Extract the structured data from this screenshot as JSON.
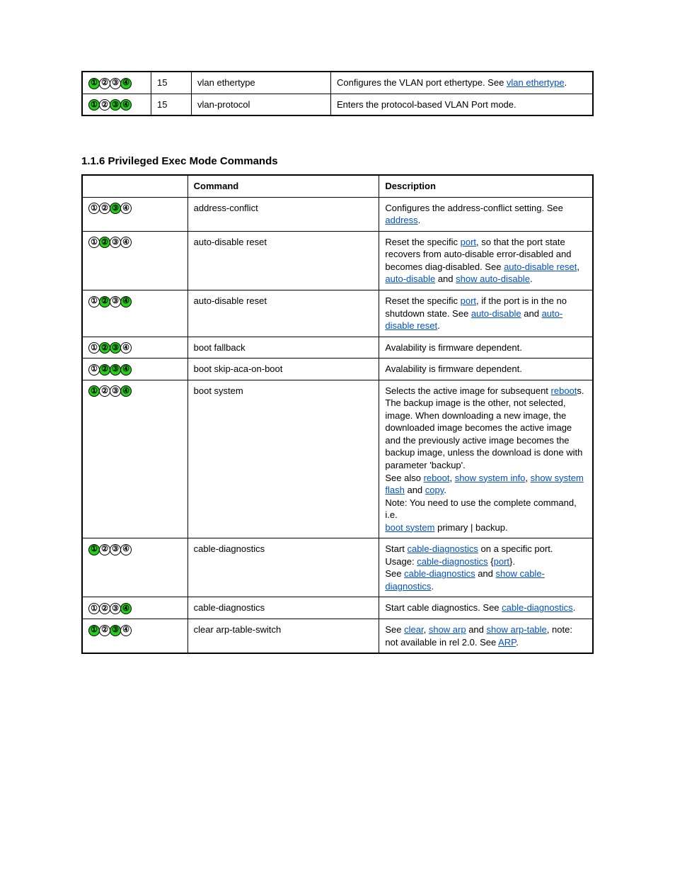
{
  "mode_glyphs": [
    "①",
    "②",
    "③",
    "④"
  ],
  "table1": {
    "rows": [
      {
        "modes": [
          true,
          false,
          false,
          true
        ],
        "priv": "15",
        "cmd": "vlan ethertype",
        "desc_parts": [
          {
            "t": "text",
            "v": "Configures the VLAN port ethertype. See "
          },
          {
            "t": "link",
            "v": "vlan ethertype"
          },
          {
            "t": "text",
            "v": "."
          }
        ]
      },
      {
        "modes": [
          true,
          false,
          true,
          true
        ],
        "priv": "15",
        "cmd": "vlan-protocol",
        "desc_parts": [
          {
            "t": "text",
            "v": "Enters the protocol-based VLAN Port mode."
          }
        ]
      }
    ]
  },
  "section_title": "1.1.6 Privileged Exec Mode Commands",
  "table2": {
    "headers": [
      "",
      "Command",
      "Description"
    ],
    "rows": [
      {
        "modes": [
          false,
          false,
          true,
          false
        ],
        "cmd": "address-conflict",
        "desc_parts": [
          {
            "t": "text",
            "v": "Configures the address-conflict setting. See "
          },
          {
            "t": "link",
            "v": "address"
          },
          {
            "t": "text",
            "v": "."
          }
        ]
      },
      {
        "modes": [
          false,
          true,
          false,
          false
        ],
        "cmd": "auto-disable reset",
        "desc_parts": [
          {
            "t": "text",
            "v": "Reset the specific "
          },
          {
            "t": "link",
            "v": "port"
          },
          {
            "t": "text",
            "v": ", so that the port state recovers from auto-disable error-disabled and becomes diag-disabled. See "
          },
          {
            "t": "link",
            "v": "auto-disable reset"
          },
          {
            "t": "text",
            "v": ", "
          },
          {
            "t": "link",
            "v": "auto-disable"
          },
          {
            "t": "text",
            "v": " and "
          },
          {
            "t": "link",
            "v": "show auto-disable"
          },
          {
            "t": "text",
            "v": "."
          }
        ]
      },
      {
        "modes": [
          false,
          true,
          false,
          true
        ],
        "cmd": "auto-disable reset",
        "desc_parts": [
          {
            "t": "text",
            "v": "Reset the specific "
          },
          {
            "t": "link",
            "v": "port"
          },
          {
            "t": "text",
            "v": ", if the port is in the no shutdown state. See "
          },
          {
            "t": "link",
            "v": "auto-disable"
          },
          {
            "t": "text",
            "v": " and "
          },
          {
            "t": "link",
            "v": "auto-disable reset"
          },
          {
            "t": "text",
            "v": "."
          }
        ]
      },
      {
        "modes": [
          false,
          true,
          true,
          false
        ],
        "cmd": "boot fallback",
        "desc_parts": [
          {
            "t": "text",
            "v": "Avalability is firmware dependent."
          }
        ]
      },
      {
        "modes": [
          false,
          true,
          true,
          true
        ],
        "cmd": "boot skip-aca-on-boot",
        "desc_parts": [
          {
            "t": "text",
            "v": "Avalability is firmware dependent."
          }
        ]
      },
      {
        "modes": [
          true,
          false,
          false,
          true
        ],
        "cmd": "boot system",
        "desc_parts": [
          {
            "t": "text",
            "v": "Selects the active image for subsequent "
          },
          {
            "t": "link",
            "v": "reboot"
          },
          {
            "t": "text",
            "v": "s. The backup image is the other, not selected, image. When downloading a new image, the downloaded image becomes the active image and the previously active image becomes the backup image, unless the download is done with parameter 'backup'."
          },
          {
            "t": "br"
          },
          {
            "t": "text",
            "v": "See also "
          },
          {
            "t": "link",
            "v": "reboot"
          },
          {
            "t": "text",
            "v": ", "
          },
          {
            "t": "link",
            "v": "show system info"
          },
          {
            "t": "text",
            "v": ", "
          },
          {
            "t": "link",
            "v": "show system flash"
          },
          {
            "t": "text",
            "v": " and "
          },
          {
            "t": "link",
            "v": "copy"
          },
          {
            "t": "text",
            "v": "."
          },
          {
            "t": "br"
          },
          {
            "t": "text",
            "v": "Note: You need to use the complete command, i.e."
          },
          {
            "t": "br"
          },
          {
            "t": "link",
            "v": "boot system"
          },
          {
            "t": "text",
            "v": " primary | backup."
          }
        ]
      },
      {
        "modes": [
          true,
          false,
          false,
          false
        ],
        "cmd": "cable-diagnostics",
        "desc_parts": [
          {
            "t": "text",
            "v": "Start "
          },
          {
            "t": "link",
            "v": "cable-diagnostics"
          },
          {
            "t": "text",
            "v": " on a specific port."
          },
          {
            "t": "br"
          },
          {
            "t": "text",
            "v": "Usage: "
          },
          {
            "t": "link",
            "v": "cable-diagnostics"
          },
          {
            "t": "text",
            "v": " {"
          },
          {
            "t": "link",
            "v": "port"
          },
          {
            "t": "text",
            "v": "}."
          },
          {
            "t": "br"
          },
          {
            "t": "text",
            "v": "See "
          },
          {
            "t": "link",
            "v": "cable-diagnostics"
          },
          {
            "t": "text",
            "v": " and "
          },
          {
            "t": "link",
            "v": "show cable-diagnostics"
          },
          {
            "t": "text",
            "v": "."
          }
        ]
      },
      {
        "modes": [
          false,
          false,
          false,
          true
        ],
        "cmd": "cable-diagnostics",
        "desc_parts": [
          {
            "t": "text",
            "v": "Start cable diagnostics. See "
          },
          {
            "t": "link",
            "v": "cable-diagnostics"
          },
          {
            "t": "text",
            "v": "."
          }
        ]
      },
      {
        "modes": [
          true,
          false,
          true,
          false
        ],
        "cmd": "clear arp-table-switch",
        "desc_parts": [
          {
            "t": "text",
            "v": "See "
          },
          {
            "t": "link",
            "v": "clear"
          },
          {
            "t": "text",
            "v": ", "
          },
          {
            "t": "link",
            "v": "show arp"
          },
          {
            "t": "text",
            "v": " and "
          },
          {
            "t": "link",
            "v": "show arp-table"
          },
          {
            "t": "text",
            "v": ", note: not available in rel 2.0. See "
          },
          {
            "t": "link",
            "v": "ARP"
          },
          {
            "t": "text",
            "v": "."
          }
        ]
      }
    ]
  }
}
